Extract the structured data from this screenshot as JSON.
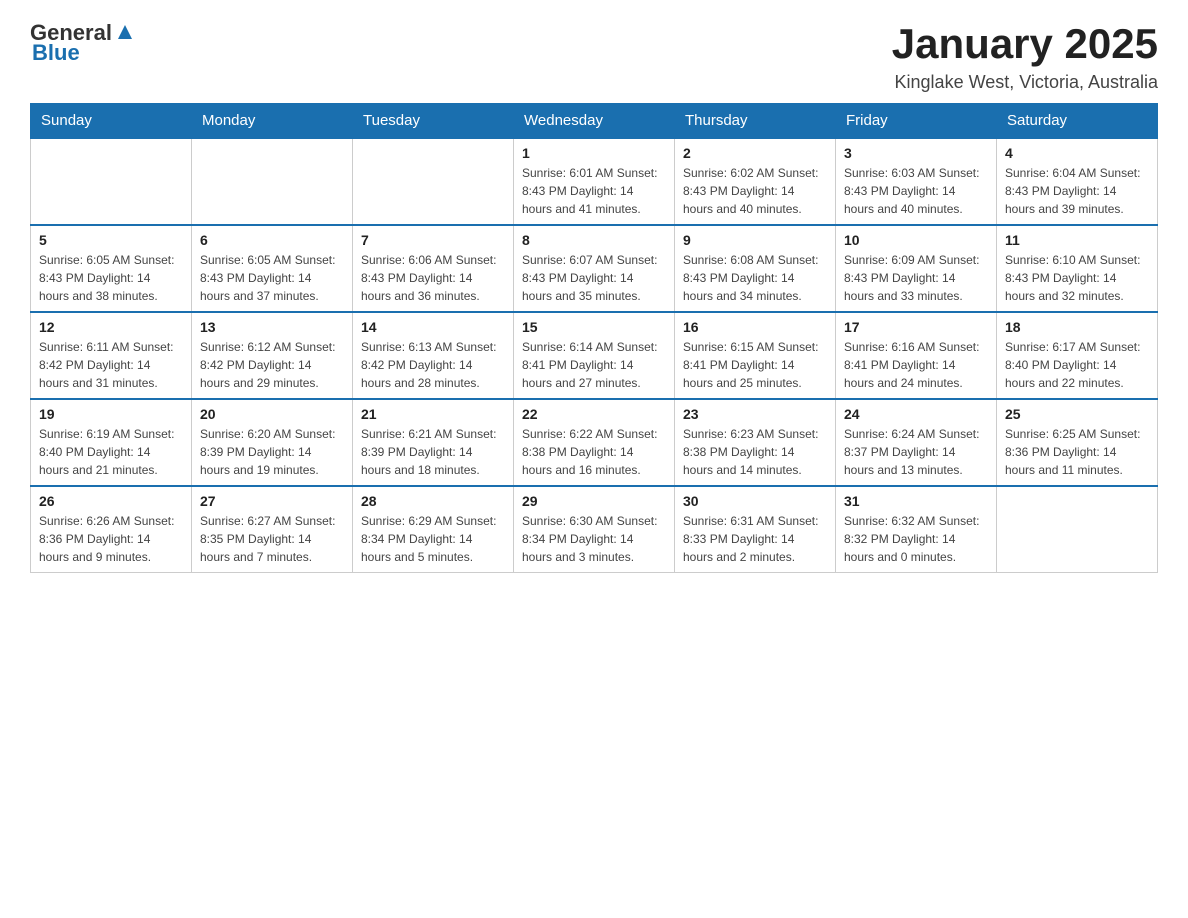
{
  "header": {
    "logo_general": "General",
    "logo_blue": "Blue",
    "title": "January 2025",
    "subtitle": "Kinglake West, Victoria, Australia"
  },
  "calendar": {
    "days_of_week": [
      "Sunday",
      "Monday",
      "Tuesday",
      "Wednesday",
      "Thursday",
      "Friday",
      "Saturday"
    ],
    "weeks": [
      [
        {
          "day": "",
          "info": ""
        },
        {
          "day": "",
          "info": ""
        },
        {
          "day": "",
          "info": ""
        },
        {
          "day": "1",
          "info": "Sunrise: 6:01 AM\nSunset: 8:43 PM\nDaylight: 14 hours and 41 minutes."
        },
        {
          "day": "2",
          "info": "Sunrise: 6:02 AM\nSunset: 8:43 PM\nDaylight: 14 hours and 40 minutes."
        },
        {
          "day": "3",
          "info": "Sunrise: 6:03 AM\nSunset: 8:43 PM\nDaylight: 14 hours and 40 minutes."
        },
        {
          "day": "4",
          "info": "Sunrise: 6:04 AM\nSunset: 8:43 PM\nDaylight: 14 hours and 39 minutes."
        }
      ],
      [
        {
          "day": "5",
          "info": "Sunrise: 6:05 AM\nSunset: 8:43 PM\nDaylight: 14 hours and 38 minutes."
        },
        {
          "day": "6",
          "info": "Sunrise: 6:05 AM\nSunset: 8:43 PM\nDaylight: 14 hours and 37 minutes."
        },
        {
          "day": "7",
          "info": "Sunrise: 6:06 AM\nSunset: 8:43 PM\nDaylight: 14 hours and 36 minutes."
        },
        {
          "day": "8",
          "info": "Sunrise: 6:07 AM\nSunset: 8:43 PM\nDaylight: 14 hours and 35 minutes."
        },
        {
          "day": "9",
          "info": "Sunrise: 6:08 AM\nSunset: 8:43 PM\nDaylight: 14 hours and 34 minutes."
        },
        {
          "day": "10",
          "info": "Sunrise: 6:09 AM\nSunset: 8:43 PM\nDaylight: 14 hours and 33 minutes."
        },
        {
          "day": "11",
          "info": "Sunrise: 6:10 AM\nSunset: 8:43 PM\nDaylight: 14 hours and 32 minutes."
        }
      ],
      [
        {
          "day": "12",
          "info": "Sunrise: 6:11 AM\nSunset: 8:42 PM\nDaylight: 14 hours and 31 minutes."
        },
        {
          "day": "13",
          "info": "Sunrise: 6:12 AM\nSunset: 8:42 PM\nDaylight: 14 hours and 29 minutes."
        },
        {
          "day": "14",
          "info": "Sunrise: 6:13 AM\nSunset: 8:42 PM\nDaylight: 14 hours and 28 minutes."
        },
        {
          "day": "15",
          "info": "Sunrise: 6:14 AM\nSunset: 8:41 PM\nDaylight: 14 hours and 27 minutes."
        },
        {
          "day": "16",
          "info": "Sunrise: 6:15 AM\nSunset: 8:41 PM\nDaylight: 14 hours and 25 minutes."
        },
        {
          "day": "17",
          "info": "Sunrise: 6:16 AM\nSunset: 8:41 PM\nDaylight: 14 hours and 24 minutes."
        },
        {
          "day": "18",
          "info": "Sunrise: 6:17 AM\nSunset: 8:40 PM\nDaylight: 14 hours and 22 minutes."
        }
      ],
      [
        {
          "day": "19",
          "info": "Sunrise: 6:19 AM\nSunset: 8:40 PM\nDaylight: 14 hours and 21 minutes."
        },
        {
          "day": "20",
          "info": "Sunrise: 6:20 AM\nSunset: 8:39 PM\nDaylight: 14 hours and 19 minutes."
        },
        {
          "day": "21",
          "info": "Sunrise: 6:21 AM\nSunset: 8:39 PM\nDaylight: 14 hours and 18 minutes."
        },
        {
          "day": "22",
          "info": "Sunrise: 6:22 AM\nSunset: 8:38 PM\nDaylight: 14 hours and 16 minutes."
        },
        {
          "day": "23",
          "info": "Sunrise: 6:23 AM\nSunset: 8:38 PM\nDaylight: 14 hours and 14 minutes."
        },
        {
          "day": "24",
          "info": "Sunrise: 6:24 AM\nSunset: 8:37 PM\nDaylight: 14 hours and 13 minutes."
        },
        {
          "day": "25",
          "info": "Sunrise: 6:25 AM\nSunset: 8:36 PM\nDaylight: 14 hours and 11 minutes."
        }
      ],
      [
        {
          "day": "26",
          "info": "Sunrise: 6:26 AM\nSunset: 8:36 PM\nDaylight: 14 hours and 9 minutes."
        },
        {
          "day": "27",
          "info": "Sunrise: 6:27 AM\nSunset: 8:35 PM\nDaylight: 14 hours and 7 minutes."
        },
        {
          "day": "28",
          "info": "Sunrise: 6:29 AM\nSunset: 8:34 PM\nDaylight: 14 hours and 5 minutes."
        },
        {
          "day": "29",
          "info": "Sunrise: 6:30 AM\nSunset: 8:34 PM\nDaylight: 14 hours and 3 minutes."
        },
        {
          "day": "30",
          "info": "Sunrise: 6:31 AM\nSunset: 8:33 PM\nDaylight: 14 hours and 2 minutes."
        },
        {
          "day": "31",
          "info": "Sunrise: 6:32 AM\nSunset: 8:32 PM\nDaylight: 14 hours and 0 minutes."
        },
        {
          "day": "",
          "info": ""
        }
      ]
    ]
  }
}
